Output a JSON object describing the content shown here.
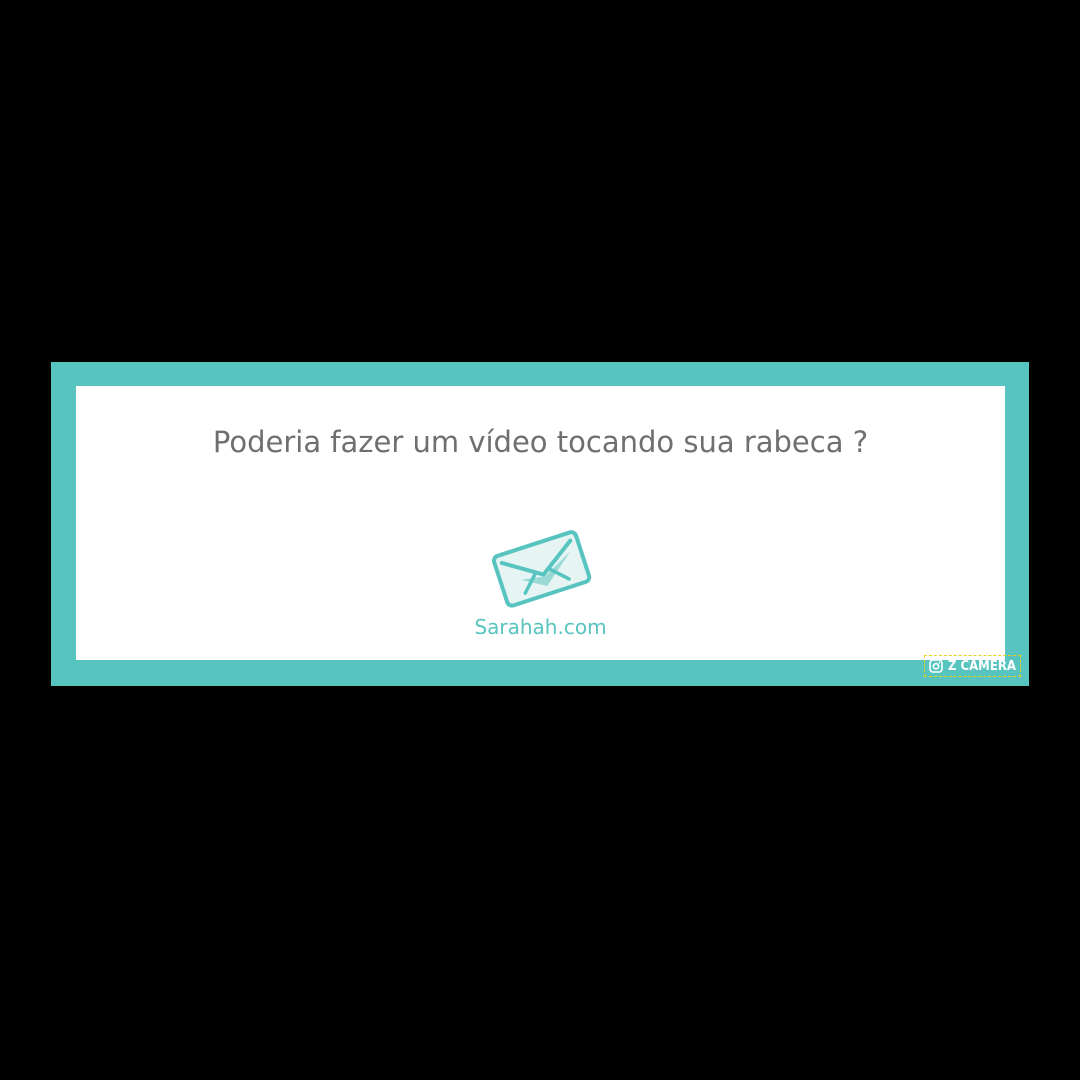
{
  "message": {
    "text": "Poderia fazer um vídeo tocando sua rabeca ?"
  },
  "brand": {
    "name": "Sarahah.com",
    "icon": "envelope-icon"
  },
  "watermark": {
    "label": "Z CAMERA",
    "icon": "instagram-camera-icon"
  },
  "colors": {
    "background": "#000000",
    "frame": "#57c4bf",
    "card": "#ffffff",
    "message_text": "#6f6f6f",
    "brand_text": "#57c4bf",
    "watermark_border": "#e2d21a"
  }
}
